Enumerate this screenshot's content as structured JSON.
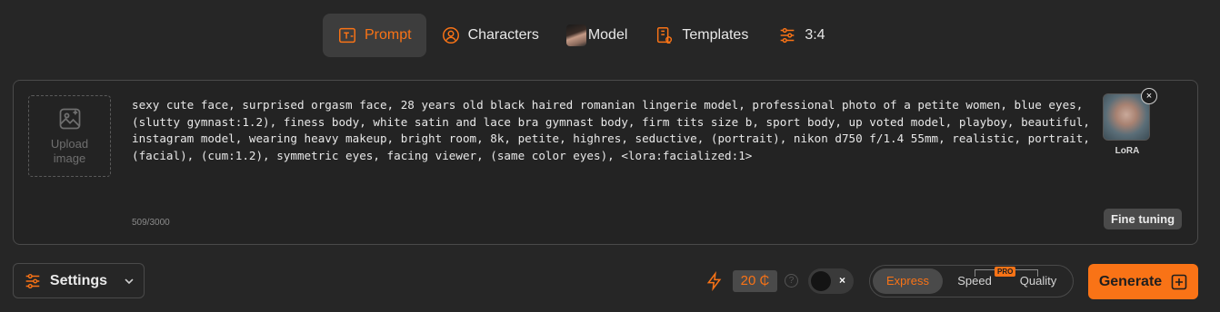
{
  "tabs": [
    {
      "label": "Prompt",
      "icon": "text-box-icon",
      "active": true
    },
    {
      "label": "Characters",
      "icon": "user-circle-icon",
      "active": false
    },
    {
      "label": "Model",
      "icon": "model-thumbnail",
      "active": false
    },
    {
      "label": "Templates",
      "icon": "templates-icon",
      "active": false
    },
    {
      "label": "3:4",
      "icon": "sliders-icon",
      "active": false
    }
  ],
  "upload": {
    "label_line1": "Upload",
    "label_line2": "image",
    "icon": "image-upload-icon"
  },
  "prompt": {
    "text": "sexy cute face, surprised orgasm face, 28 years old black haired romanian lingerie model, professional photo of a petite women, blue eyes, (slutty gymnast:1.2), finess body, white satin and lace bra gymnast body, firm tits size b, sport body, up voted model, playboy, beautiful, instagram model, wearing heavy makeup, bright room, 8k, petite, highres, seductive, (portrait), nikon d750 f/1.4 55mm, realistic, portrait, (facial), (cum:1.2), symmetric eyes, facing viewer, (same color eyes), <lora:facialized:1>",
    "counter": "509/3000"
  },
  "lora": {
    "label": "LoRA",
    "close": "×"
  },
  "fine_tuning": "Fine tuning",
  "settings": {
    "label": "Settings"
  },
  "credits": {
    "value": "20 ₵",
    "help": "?"
  },
  "toggle": {
    "off_symbol": "×"
  },
  "speed_modes": {
    "express": "Express",
    "speed": "Speed",
    "quality": "Quality",
    "pro_badge": "PRO"
  },
  "generate": {
    "label": "Generate"
  },
  "colors": {
    "accent": "#f97316",
    "background": "#262626",
    "panel": "#232323"
  }
}
